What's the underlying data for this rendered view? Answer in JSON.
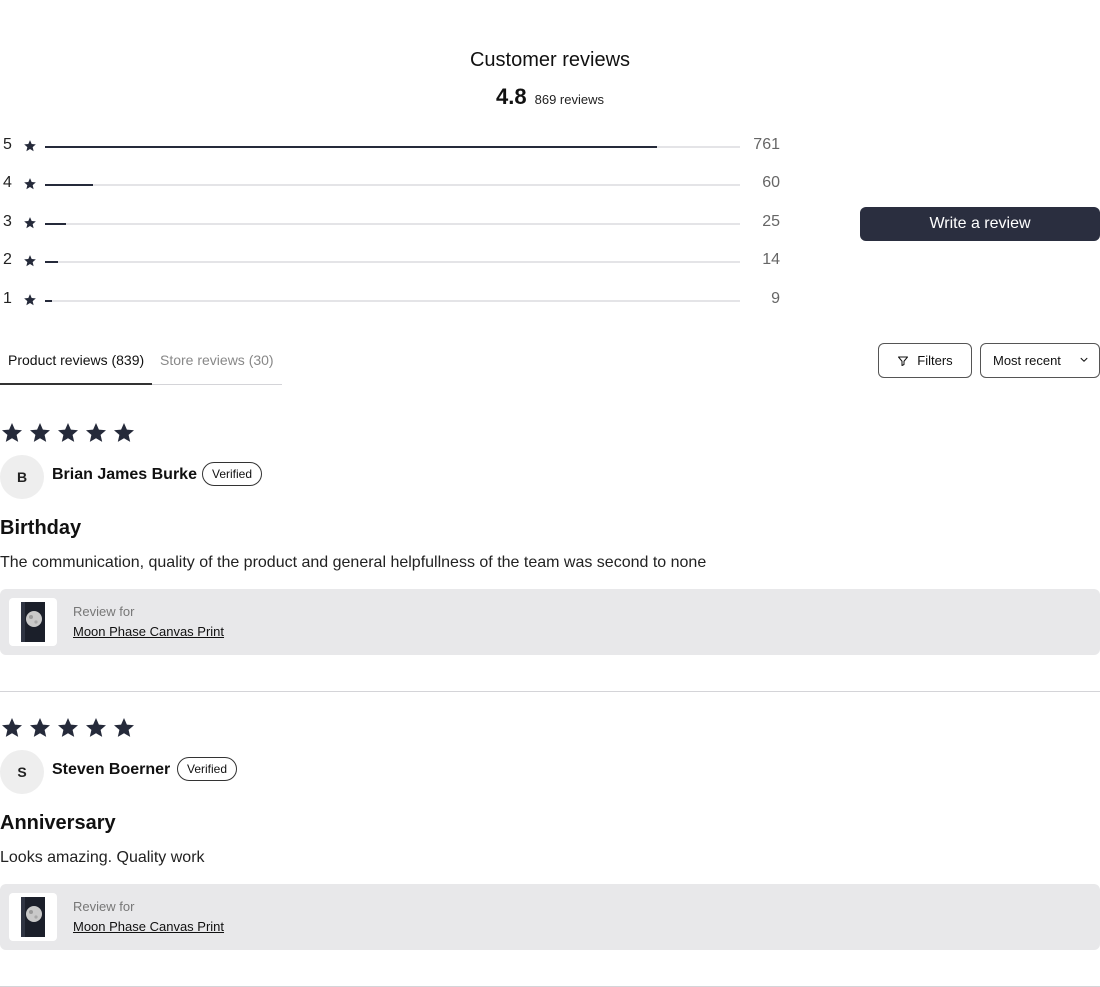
{
  "header": {
    "title": "Customer reviews",
    "average": "4.8",
    "total_label": "869 reviews"
  },
  "histogram": [
    {
      "stars": "5",
      "count": "761",
      "fraction": 0.88
    },
    {
      "stars": "4",
      "count": "60",
      "fraction": 0.069
    },
    {
      "stars": "3",
      "count": "25",
      "fraction": 0.03
    },
    {
      "stars": "2",
      "count": "14",
      "fraction": 0.019
    },
    {
      "stars": "1",
      "count": "9",
      "fraction": 0.01
    }
  ],
  "actions": {
    "write_review": "Write a review",
    "filters": "Filters",
    "sort_selected": "Most recent"
  },
  "tabs": [
    {
      "label": "Product reviews (839)",
      "active": true
    },
    {
      "label": "Store reviews (30)",
      "active": false
    }
  ],
  "reviews": [
    {
      "rating": 5,
      "initial": "B",
      "author": "Brian James Burke",
      "badge": "Verified",
      "title": "Birthday",
      "body": "The communication, quality of the product and general helpfullness of the team was second to none",
      "review_for_label": "Review for",
      "product": "Moon Phase Canvas Print"
    },
    {
      "rating": 5,
      "initial": "S",
      "author": "Steven Boerner",
      "badge": "Verified",
      "title": "Anniversary",
      "body": "Looks amazing. Quality work",
      "review_for_label": "Review for",
      "product": "Moon Phase Canvas Print"
    }
  ],
  "colors": {
    "star": "#252a3a",
    "primary_button": "#2a2e3f",
    "product_card_bg": "#e8e8ea"
  },
  "icons": {
    "star": "star-icon",
    "filter": "filter-icon",
    "chevron": "chevron-down-icon",
    "product_thumb": "moon-canvas-thumbnail"
  }
}
